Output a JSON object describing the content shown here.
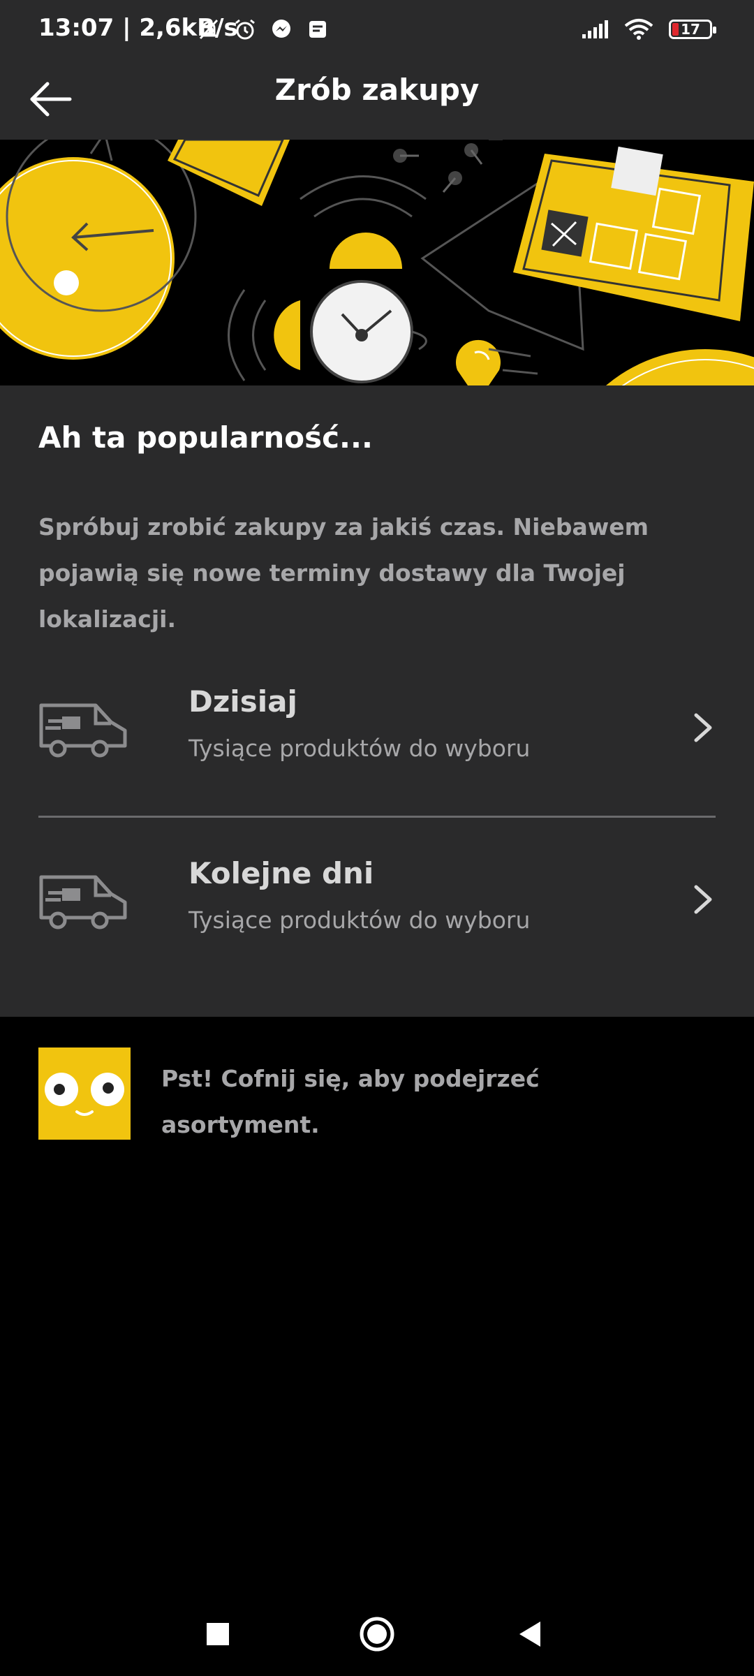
{
  "status": {
    "time": "13:07 | 2,6kB/s",
    "battery": "17",
    "icons_left": [
      "bell-off-icon",
      "alarm-icon",
      "messenger-icon",
      "notes-icon"
    ],
    "icons_right": [
      "signal-icon",
      "wifi-icon",
      "battery-icon"
    ]
  },
  "appbar": {
    "title": "Zrób zakupy",
    "back_icon": "arrow-left-icon"
  },
  "content": {
    "headline": "Ah ta popularność...",
    "description": "Spróbuj zrobić zakupy za jakiś czas. Niebawem pojawią się nowe terminy dostawy dla Twojej lokalizacji.",
    "options": [
      {
        "title": "Dzisiaj",
        "subtitle": "Tysiące produktów do wyboru",
        "icon": "delivery-van-icon"
      },
      {
        "title": "Kolejne dni",
        "subtitle": "Tysiące produktów do wyboru",
        "icon": "delivery-van-icon"
      }
    ]
  },
  "tip": {
    "text": "Pst! Cofnij się, aby podejrzeć asortyment.",
    "icon": "mascot-face-icon"
  },
  "navbar": {
    "buttons": [
      "recents-square-icon",
      "home-circle-icon",
      "back-triangle-icon"
    ]
  },
  "colors": {
    "accent": "#f1c40f",
    "surface": "#2a2a2b",
    "background": "#000000",
    "muted_text": "#a7a7a9"
  }
}
